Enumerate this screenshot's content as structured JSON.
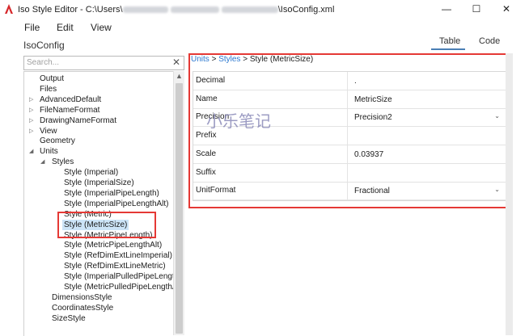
{
  "window": {
    "title_prefix": "Iso Style Editor - C:\\Users\\",
    "title_suffix": "\\IsoConfig.xml",
    "minimize": "—",
    "maximize": "☐",
    "close": "✕"
  },
  "menu": {
    "file": "File",
    "edit": "Edit",
    "view": "View"
  },
  "section_title": "IsoConfig",
  "tabs": {
    "table": "Table",
    "code": "Code"
  },
  "search": {
    "placeholder": "Search...",
    "clear": "✕"
  },
  "tree": {
    "nodes": [
      {
        "label": "Output",
        "depth": 0,
        "arrow": ""
      },
      {
        "label": "Files",
        "depth": 0,
        "arrow": ""
      },
      {
        "label": "AdvancedDefault",
        "depth": 0,
        "arrow": "▷"
      },
      {
        "label": "FileNameFormat",
        "depth": 0,
        "arrow": "▷"
      },
      {
        "label": "DrawingNameFormat",
        "depth": 0,
        "arrow": "▷"
      },
      {
        "label": "View",
        "depth": 0,
        "arrow": "▷"
      },
      {
        "label": "Geometry",
        "depth": 0,
        "arrow": ""
      },
      {
        "label": "Units",
        "depth": 0,
        "arrow": "◢"
      },
      {
        "label": "Styles",
        "depth": 1,
        "arrow": "◢"
      },
      {
        "label": "Style (Imperial)",
        "depth": 2,
        "arrow": ""
      },
      {
        "label": "Style (ImperialSize)",
        "depth": 2,
        "arrow": ""
      },
      {
        "label": "Style (ImperialPipeLength)",
        "depth": 2,
        "arrow": ""
      },
      {
        "label": "Style (ImperialPipeLengthAlt)",
        "depth": 2,
        "arrow": ""
      },
      {
        "label": "Style (Metric)",
        "depth": 2,
        "arrow": ""
      },
      {
        "label": "Style (MetricSize)",
        "depth": 2,
        "arrow": "",
        "selected": true
      },
      {
        "label": "Style (MetricPipeLength)",
        "depth": 2,
        "arrow": ""
      },
      {
        "label": "Style (MetricPipeLengthAlt)",
        "depth": 2,
        "arrow": ""
      },
      {
        "label": "Style (RefDimExtLineImperial)",
        "depth": 2,
        "arrow": ""
      },
      {
        "label": "Style (RefDimExtLineMetric)",
        "depth": 2,
        "arrow": ""
      },
      {
        "label": "Style (ImperialPulledPipeLength",
        "depth": 2,
        "arrow": ""
      },
      {
        "label": "Style (MetricPulledPipeLengthA",
        "depth": 2,
        "arrow": ""
      },
      {
        "label": "DimensionsStyle",
        "depth": 1,
        "arrow": ""
      },
      {
        "label": "CoordinatesStyle",
        "depth": 1,
        "arrow": ""
      },
      {
        "label": "SizeStyle",
        "depth": 1,
        "arrow": ""
      }
    ]
  },
  "breadcrumb": {
    "units": "Units",
    "sep": " > ",
    "styles": "Styles",
    "current": "Style (MetricSize)"
  },
  "properties": [
    {
      "name": "Decimal",
      "value": ".",
      "dropdown": false
    },
    {
      "name": "Name",
      "value": "MetricSize",
      "dropdown": false
    },
    {
      "name": "Precision",
      "value": "Precision2",
      "dropdown": true
    },
    {
      "name": "Prefix",
      "value": "",
      "dropdown": false
    },
    {
      "name": "Scale",
      "value": "0.03937",
      "dropdown": false
    },
    {
      "name": "Suffix",
      "value": "",
      "dropdown": false
    },
    {
      "name": "UnitFormat",
      "value": "Fractional",
      "dropdown": true
    }
  ],
  "watermark": "小乐笔记",
  "colors": {
    "accent": "#2b78d0",
    "selection": "#cce4f7",
    "highlight": "#e53935"
  }
}
